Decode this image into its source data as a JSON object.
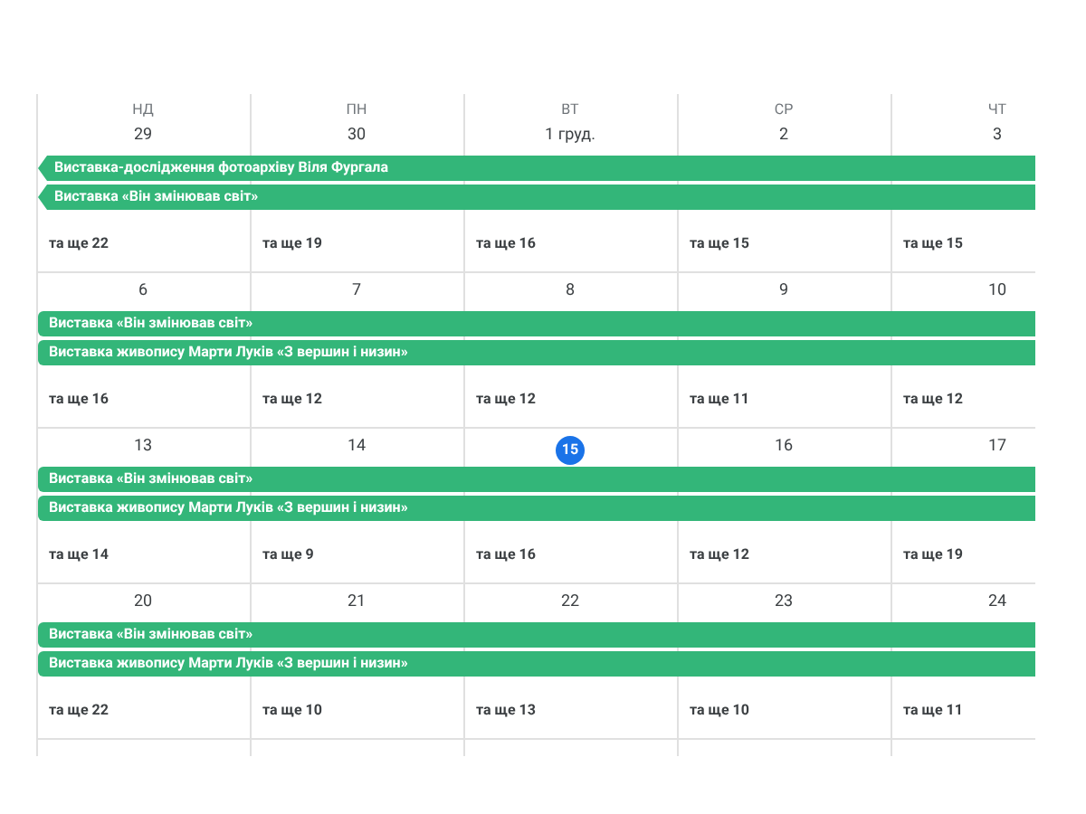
{
  "weekdays": [
    "НД",
    "ПН",
    "ВТ",
    "СР",
    "ЧТ"
  ],
  "weeks": [
    {
      "days": [
        {
          "date": "29",
          "today": false,
          "more": "та ще 22"
        },
        {
          "date": "30",
          "today": false,
          "more": "та ще 19"
        },
        {
          "date": "1 груд.",
          "today": false,
          "more": "та ще 16"
        },
        {
          "date": "2",
          "today": false,
          "more": "та ще 15"
        },
        {
          "date": "3",
          "today": false,
          "more": "та ще 15"
        }
      ],
      "events": [
        {
          "title": "Виставка-дослідження фотоархіву Віля Фургала",
          "continues_before": true
        },
        {
          "title": "Виставка «Він змінював світ»",
          "continues_before": true
        }
      ]
    },
    {
      "days": [
        {
          "date": "6",
          "today": false,
          "more": "та ще 16"
        },
        {
          "date": "7",
          "today": false,
          "more": "та ще 12"
        },
        {
          "date": "8",
          "today": false,
          "more": "та ще 12"
        },
        {
          "date": "9",
          "today": false,
          "more": "та ще 11"
        },
        {
          "date": "10",
          "today": false,
          "more": "та ще 12"
        }
      ],
      "events": [
        {
          "title": "Виставка «Він змінював світ»",
          "continues_before": false
        },
        {
          "title": "Виставка живопису Марти Луків «З вершин і низин»",
          "continues_before": false
        }
      ]
    },
    {
      "days": [
        {
          "date": "13",
          "today": false,
          "more": "та ще 14"
        },
        {
          "date": "14",
          "today": false,
          "more": "та ще 9"
        },
        {
          "date": "15",
          "today": true,
          "more": "та ще 16"
        },
        {
          "date": "16",
          "today": false,
          "more": "та ще 12"
        },
        {
          "date": "17",
          "today": false,
          "more": "та ще 19"
        }
      ],
      "events": [
        {
          "title": "Виставка «Він змінював світ»",
          "continues_before": false
        },
        {
          "title": "Виставка живопису Марти Луків «З вершин і низин»",
          "continues_before": false
        }
      ]
    },
    {
      "days": [
        {
          "date": "20",
          "today": false,
          "more": "та ще 22"
        },
        {
          "date": "21",
          "today": false,
          "more": "та ще 10"
        },
        {
          "date": "22",
          "today": false,
          "more": "та ще 13"
        },
        {
          "date": "23",
          "today": false,
          "more": "та ще 10"
        },
        {
          "date": "24",
          "today": false,
          "more": "та ще 11"
        }
      ],
      "events": [
        {
          "title": "Виставка «Він змінював світ»",
          "continues_before": false
        },
        {
          "title": "Виставка живопису Марти Луків «З вершин і низин»",
          "continues_before": false
        }
      ]
    }
  ]
}
